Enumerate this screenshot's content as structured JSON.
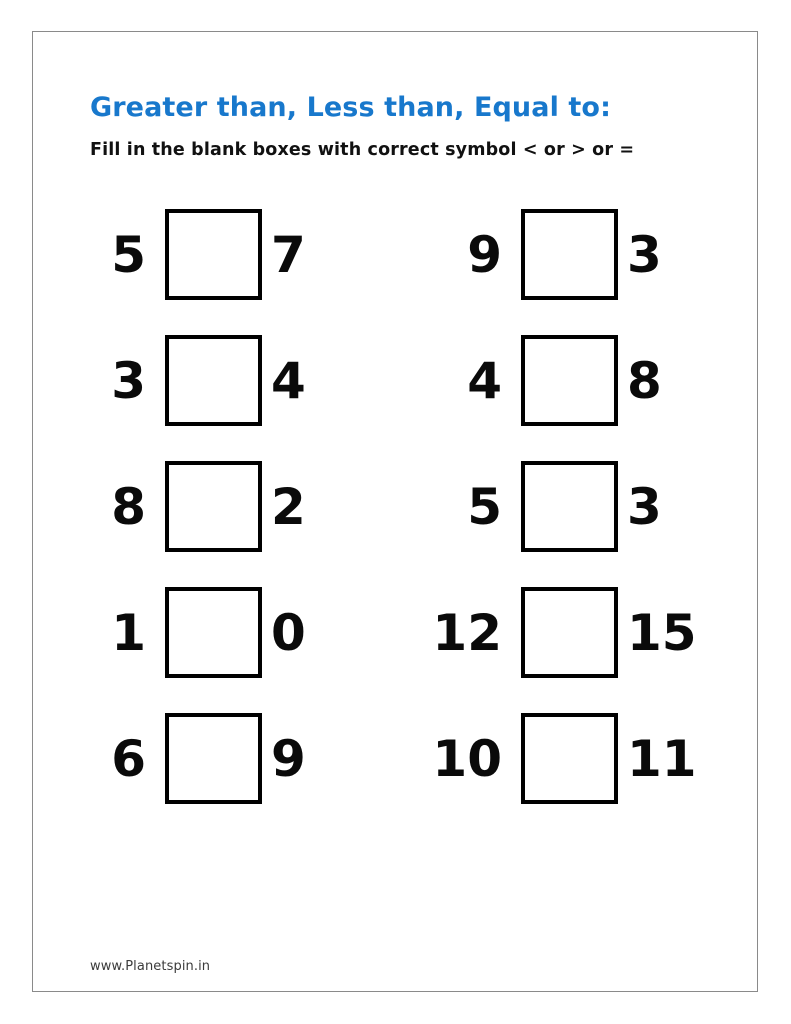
{
  "page": {
    "background_color": "#ffffff",
    "frame_color": "#8a8a8a"
  },
  "header": {
    "title": "Greater than, Less than, Equal to:",
    "title_color": "#1878cc",
    "instruction": "Fill in the blank boxes with correct symbol < or > or =",
    "instruction_color": "#111111"
  },
  "worksheet": {
    "answer_box_placeholder": "",
    "columns": [
      {
        "id": "left-column",
        "rows": [
          {
            "left": "5",
            "right": "7"
          },
          {
            "left": "3",
            "right": "4"
          },
          {
            "left": "8",
            "right": "2"
          },
          {
            "left": "1",
            "right": "0"
          },
          {
            "left": "6",
            "right": "9"
          }
        ]
      },
      {
        "id": "right-column",
        "rows": [
          {
            "left": "9",
            "right": "3"
          },
          {
            "left": "4",
            "right": "8"
          },
          {
            "left": "5",
            "right": "3"
          },
          {
            "left": "12",
            "right": "15"
          },
          {
            "left": "10",
            "right": "11"
          }
        ]
      }
    ]
  },
  "footer": {
    "website": "www.Planetspin.in"
  }
}
